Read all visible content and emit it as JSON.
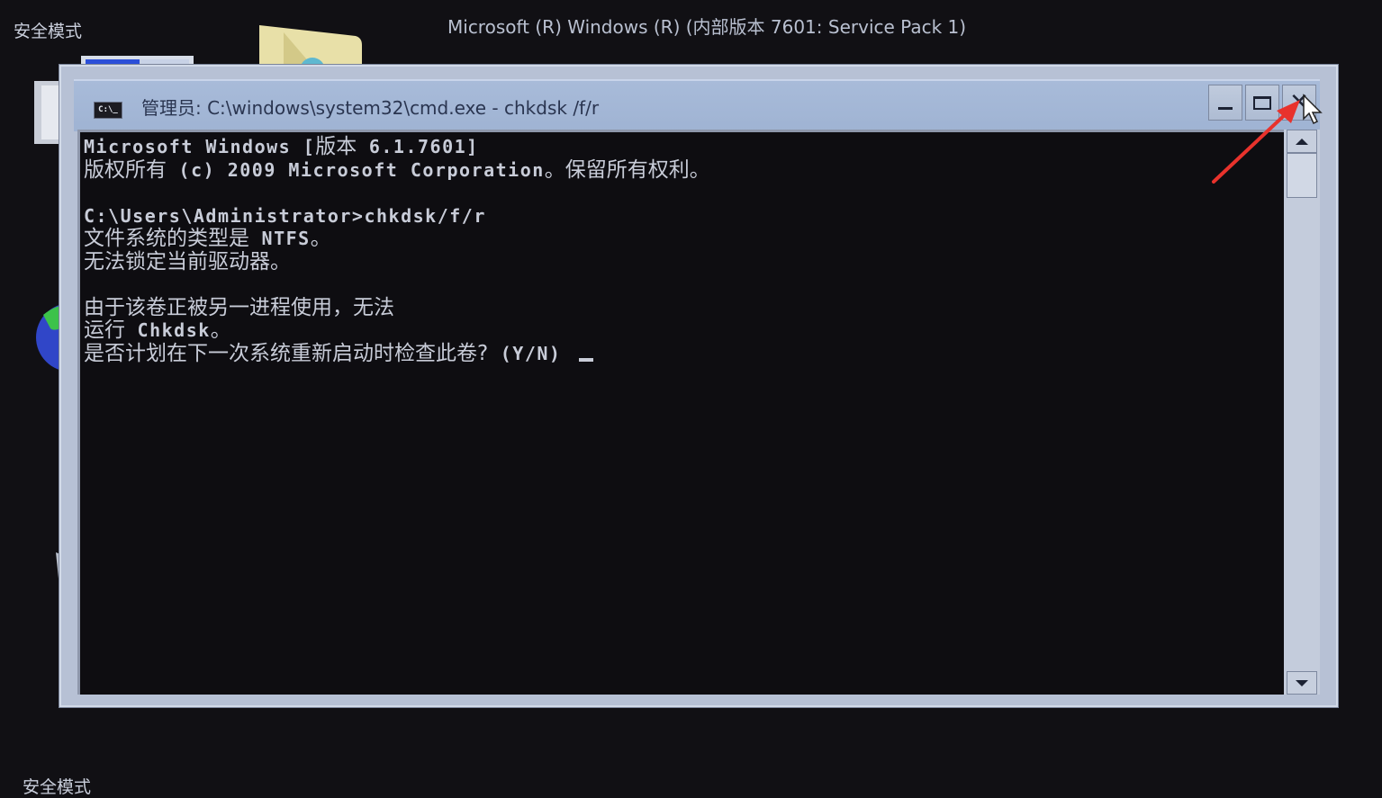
{
  "desktop": {
    "safe_mode_top_left": "安全模式",
    "safe_mode_bottom_left": "安全模式",
    "os_banner": "Microsoft (R) Windows (R) (内部版本 7601: Service Pack 1)",
    "icons": [
      "computer-icon",
      "folder-icon",
      "network-globe-icon",
      "recycle-bin-icon"
    ]
  },
  "window": {
    "icon_label": "C:\\_",
    "title": "管理员: C:\\windows\\system32\\cmd.exe - chkdsk /f/r",
    "buttons": {
      "minimize": "minimize",
      "maximize": "maximize",
      "close": "✕"
    }
  },
  "console": {
    "lines": [
      [
        {
          "t": "ascii",
          "v": "Microsoft Windows "
        },
        {
          "t": "ascii",
          "v": "["
        },
        {
          "t": "cn",
          "v": "版本"
        },
        {
          "t": "ascii",
          "v": " 6.1.7601]"
        }
      ],
      [
        {
          "t": "cn",
          "v": "版权所有"
        },
        {
          "t": "ascii",
          "v": " (c) 2009 Microsoft Corporation"
        },
        {
          "t": "cn",
          "v": "。保留所有权利。"
        }
      ],
      [],
      [
        {
          "t": "ascii",
          "v": "C:\\Users\\Administrator>chkdsk/f/r"
        }
      ],
      [
        {
          "t": "cn",
          "v": "文件系统的类型是"
        },
        {
          "t": "ascii",
          "v": " NTFS"
        },
        {
          "t": "cn",
          "v": "。"
        }
      ],
      [
        {
          "t": "cn",
          "v": "无法锁定当前驱动器。"
        }
      ],
      [],
      [
        {
          "t": "cn",
          "v": "由于该卷正被另一进程使用，无法"
        }
      ],
      [
        {
          "t": "cn",
          "v": "运行"
        },
        {
          "t": "ascii",
          "v": " Chkdsk"
        },
        {
          "t": "cn",
          "v": "。"
        }
      ],
      [
        {
          "t": "cn",
          "v": "是否计划在下一次系统重新启动时检查此卷?"
        },
        {
          "t": "ascii",
          "v": " (Y/N) "
        },
        {
          "t": "cursor",
          "v": ""
        }
      ]
    ]
  },
  "colors": {
    "annotation_arrow": "#e8322c",
    "console_bg": "#0e0d11",
    "console_fg": "#c8ccd8",
    "titlebar": "#a8bbd9"
  }
}
